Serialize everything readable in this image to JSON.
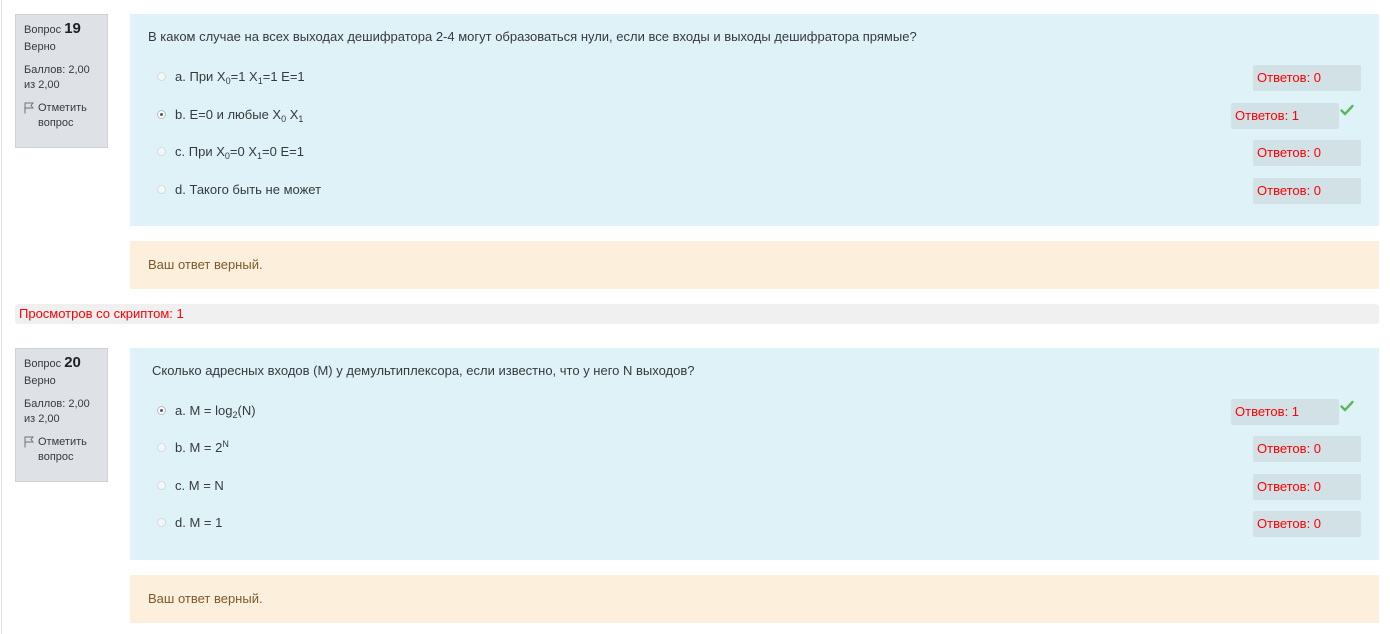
{
  "questions": [
    {
      "label": "Вопрос",
      "number": "19",
      "state": "Верно",
      "grade": "Баллов: 2,00 из 2,00",
      "flag_label": "Отметить вопрос",
      "text": "В каком случае на всех выходах дешифратора 2-4 могут образоваться нули, если все входы и выходы дешифратора прямые?",
      "answers": [
        {
          "letter": "a.",
          "content": "При X<sub>0</sub>=1 X<sub>1</sub>=1 E=1",
          "checked": false,
          "count": "Ответов: 0",
          "correct": false
        },
        {
          "letter": "b.",
          "content": "E=0 и любые X<sub>0</sub> X<sub>1</sub>",
          "checked": true,
          "count": "Ответов: 1",
          "correct": true
        },
        {
          "letter": "c.",
          "content": "При X<sub>0</sub>=0 X<sub>1</sub>=0 E=1",
          "checked": false,
          "count": "Ответов: 0",
          "correct": false
        },
        {
          "letter": "d.",
          "content": "Такого быть не может",
          "checked": false,
          "count": "Ответов: 0",
          "correct": false
        }
      ],
      "feedback": "Ваш ответ верный."
    },
    {
      "label": "Вопрос",
      "number": "20",
      "state": "Верно",
      "grade": "Баллов: 2,00 из 2,00",
      "flag_label": "Отметить вопрос",
      "text": "Сколько адресных входов (M) у демультиплексора, если известно, что у него N выходов?",
      "answers": [
        {
          "letter": "a.",
          "content": "M = log<sub>2</sub>(N)",
          "checked": true,
          "count": "Ответов: 1",
          "correct": true
        },
        {
          "letter": "b.",
          "content": "M = 2<sup>N</sup>",
          "checked": false,
          "count": "Ответов: 0",
          "correct": false
        },
        {
          "letter": "c.",
          "content": "M = N",
          "checked": false,
          "count": "Ответов: 0",
          "correct": false
        },
        {
          "letter": "d.",
          "content": "M = 1",
          "checked": false,
          "count": "Ответов: 0",
          "correct": false
        }
      ],
      "feedback": "Ваш ответ верный."
    }
  ],
  "views_text": "Просмотров со скриптом: 1",
  "colors": {
    "formulation_bg": "#def2f8",
    "feedback_bg": "#fcefdc",
    "count_text": "#ff0000",
    "correct_check": "#5cb85c"
  },
  "icons": {
    "flag": "flag-icon",
    "correct": "check-icon"
  }
}
